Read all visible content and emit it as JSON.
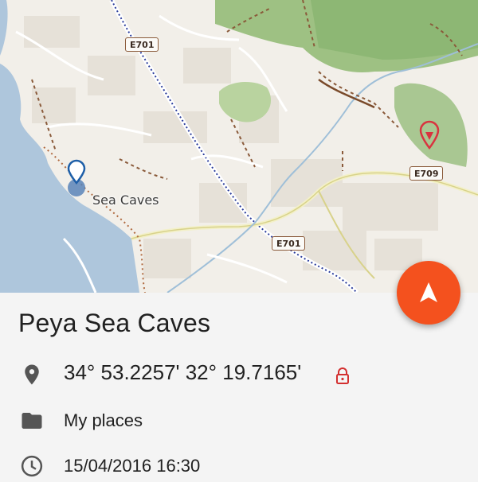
{
  "map": {
    "place_label": "Sea Caves",
    "road_shields": [
      "E701",
      "E701",
      "E709"
    ],
    "colors": {
      "sea": "#aec6dc",
      "land": "#f2efe9",
      "park": "#9ec183",
      "marker_blue": "#1e5fa8",
      "marker_red": "#d9333f"
    }
  },
  "fab": {
    "icon": "navigation-arrow-icon",
    "color": "#f4511e"
  },
  "details": {
    "title": "Peya Sea Caves",
    "coordinates": "34° 53.2257' 32° 19.7165'",
    "coordinates_icon": "location-pin-icon",
    "lock_icon": "lock-icon",
    "lock_color": "#d32f2f",
    "folder_icon": "folder-icon",
    "folder": "My places",
    "time_icon": "clock-icon",
    "timestamp": "15/04/2016 16:30"
  }
}
